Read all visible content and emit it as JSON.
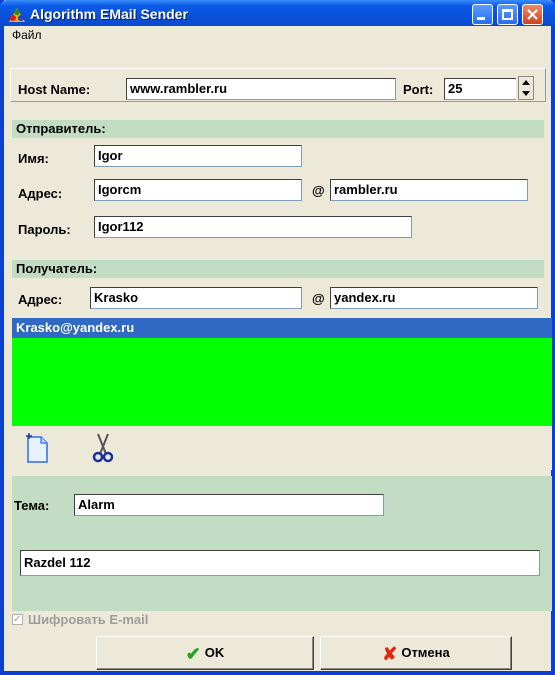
{
  "window": {
    "title": "Algorithm EMail Sender"
  },
  "menu": {
    "file": "Файл"
  },
  "host": {
    "label": "Host Name:",
    "value": "www.rambler.ru",
    "port_label": "Port:",
    "port_value": "25"
  },
  "sender": {
    "header": "Отправитель:",
    "name_label": "Имя:",
    "name_value": "Igor",
    "address_label": "Адрес:",
    "address_user": "Igorcm",
    "at": "@",
    "address_domain": "rambler.ru",
    "password_label": "Пароль:",
    "password_value": "Igor112"
  },
  "recipient": {
    "header": "Получатель:",
    "address_label": "Адрес:",
    "address_user": "Krasko",
    "at": "@",
    "address_domain": "yandex.ru"
  },
  "recipients_list": [
    "Krasko@yandex.ru"
  ],
  "toolbar": {
    "new_icon": "new-document-icon",
    "cut_icon": "scissors-icon"
  },
  "message": {
    "subject_label": "Тема:",
    "subject_value": "Alarm",
    "body_value": "Razdel 112"
  },
  "encrypt": {
    "label": "Шифровать E-mail",
    "checked": true
  },
  "buttons": {
    "ok": "OK",
    "cancel": "Отмена"
  },
  "colors": {
    "list_bg": "#00ff00",
    "selected_row": "#316ac5",
    "section_bar": "#c3dcc4"
  }
}
